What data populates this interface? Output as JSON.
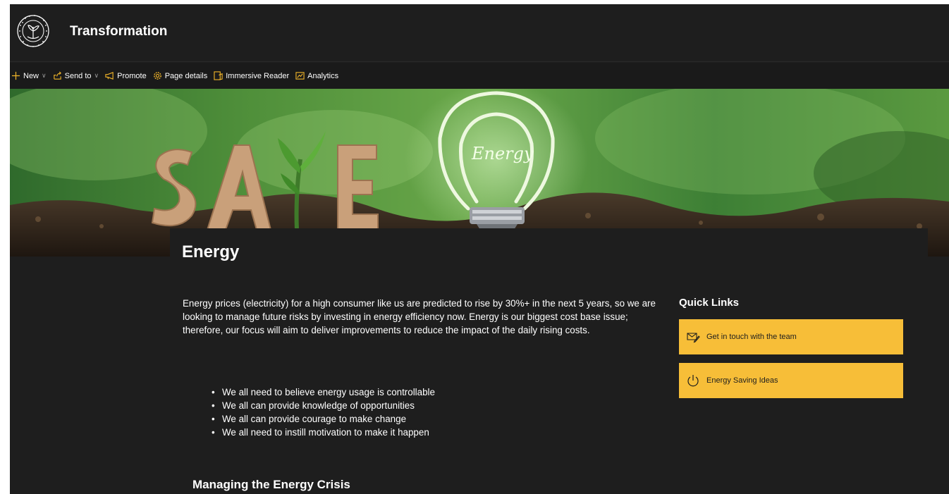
{
  "site": {
    "title": "Transformation",
    "logo_text": "TRANSFORMING PORTAL"
  },
  "command_bar": {
    "items": [
      {
        "label": "New",
        "icon": "plus-icon",
        "has_dropdown": true
      },
      {
        "label": "Send to",
        "icon": "share-icon",
        "has_dropdown": true
      },
      {
        "label": "Promote",
        "icon": "megaphone-icon",
        "has_dropdown": false
      },
      {
        "label": "Page details",
        "icon": "gear-icon",
        "has_dropdown": false
      },
      {
        "label": "Immersive Reader",
        "icon": "reader-icon",
        "has_dropdown": false
      },
      {
        "label": "Analytics",
        "icon": "analytics-icon",
        "has_dropdown": false
      }
    ]
  },
  "hero": {
    "description": "SAVE Energy banner",
    "letters": "SAVE",
    "bulb_text": "Energy"
  },
  "page": {
    "title": "Energy",
    "intro": "Energy prices (electricity) for a high consumer like us are predicted to rise by 30%+ in the next 5 years, so we are looking to manage future risks by investing in energy efficiency now. Energy is our biggest cost base issue; therefore, our focus will aim to deliver improvements to reduce the impact of the daily rising costs.",
    "bullets": [
      "We all need to believe energy usage is controllable",
      "We all can provide knowledge of opportunities",
      "We all can provide courage to make change",
      "We all need to instill motivation to make it happen"
    ],
    "section_heading": "Managing the Energy Crisis"
  },
  "quick_links": {
    "title": "Quick Links",
    "links": [
      {
        "label": "Get in touch with the team",
        "icon": "mail-icon"
      },
      {
        "label": "Energy Saving Ideas",
        "icon": "power-icon"
      }
    ]
  },
  "colors": {
    "accent": "#f7be38",
    "background": "#1e1e1e",
    "command_icon": "#f0b429"
  }
}
